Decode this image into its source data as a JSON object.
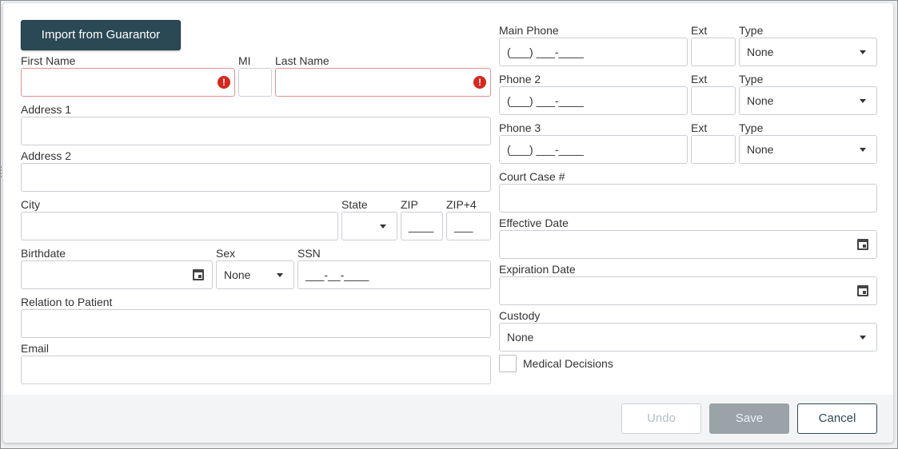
{
  "toolbar": {
    "import_label": "Import from Guarantor"
  },
  "fields": {
    "first_name": {
      "label": "First Name",
      "value": ""
    },
    "mi": {
      "label": "MI",
      "value": ""
    },
    "last_name": {
      "label": "Last Name",
      "value": ""
    },
    "address1": {
      "label": "Address 1",
      "value": ""
    },
    "address2": {
      "label": "Address 2",
      "value": ""
    },
    "city": {
      "label": "City",
      "value": ""
    },
    "state": {
      "label": "State",
      "value": ""
    },
    "zip": {
      "label": "ZIP",
      "mask": "____"
    },
    "zip4": {
      "label": "ZIP+4",
      "mask": "___"
    },
    "birthdate": {
      "label": "Birthdate",
      "value": ""
    },
    "sex": {
      "label": "Sex",
      "value": "None"
    },
    "ssn": {
      "label": "SSN",
      "mask": "___-__-____"
    },
    "relation": {
      "label": "Relation to Patient",
      "value": ""
    },
    "email": {
      "label": "Email",
      "value": ""
    },
    "main_phone": {
      "label": "Main Phone",
      "mask": "(___) ___-____"
    },
    "main_ext": {
      "label": "Ext",
      "value": ""
    },
    "main_type": {
      "label": "Type",
      "value": "None"
    },
    "phone2": {
      "label": "Phone 2",
      "mask": "(___) ___-____"
    },
    "phone2_ext": {
      "label": "Ext",
      "value": ""
    },
    "phone2_type": {
      "label": "Type",
      "value": "None"
    },
    "phone3": {
      "label": "Phone 3",
      "mask": "(___) ___-____"
    },
    "phone3_ext": {
      "label": "Ext",
      "value": ""
    },
    "phone3_type": {
      "label": "Type",
      "value": "None"
    },
    "court_case": {
      "label": "Court Case #",
      "value": ""
    },
    "effective_date": {
      "label": "Effective Date",
      "value": ""
    },
    "expiration_date": {
      "label": "Expiration Date",
      "value": ""
    },
    "custody": {
      "label": "Custody",
      "value": "None"
    },
    "medical_decisions": {
      "label": "Medical Decisions",
      "checked": false
    }
  },
  "validation": {
    "error_symbol": "!"
  },
  "footer": {
    "undo_label": "Undo",
    "save_label": "Save",
    "cancel_label": "Cancel"
  },
  "colors": {
    "primary": "#2b4955",
    "error": "#d6281d",
    "disabled_save": "#9aa3a8"
  }
}
